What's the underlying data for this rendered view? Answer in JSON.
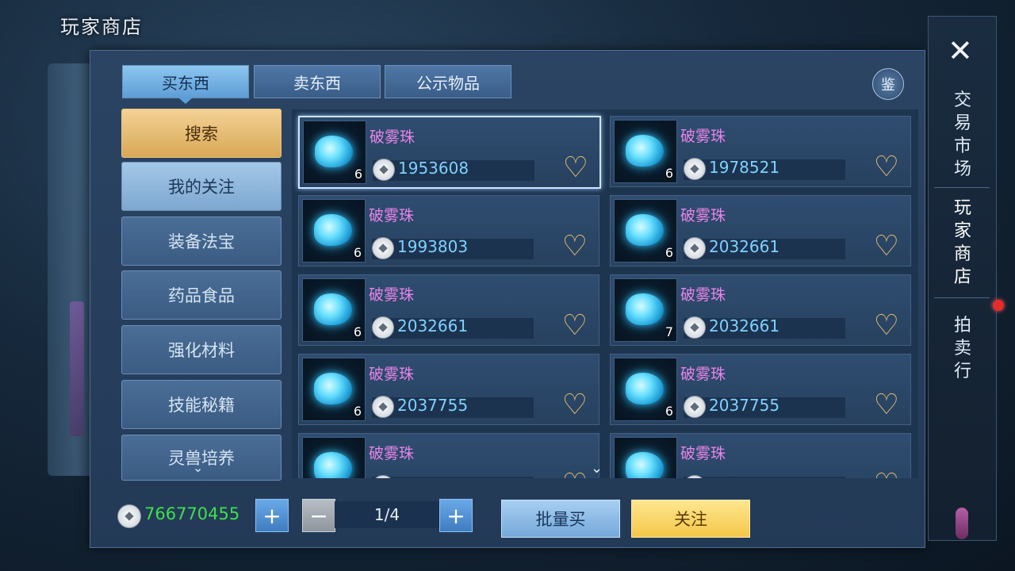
{
  "page_title": "玩家商店",
  "tabs": [
    {
      "label": "买东西",
      "active": true
    },
    {
      "label": "卖东西",
      "active": false
    },
    {
      "label": "公示物品",
      "active": false
    }
  ],
  "appraise_button": "鉴",
  "sidebar": {
    "search": "搜索",
    "items": [
      "我的关注",
      "装备法宝",
      "药品食品",
      "强化材料",
      "技能秘籍",
      "灵兽培养"
    ]
  },
  "listings": [
    {
      "name": "破雾珠",
      "qty": "6",
      "price": "1953608"
    },
    {
      "name": "破雾珠",
      "qty": "6",
      "price": "1978521"
    },
    {
      "name": "破雾珠",
      "qty": "6",
      "price": "1993803"
    },
    {
      "name": "破雾珠",
      "qty": "6",
      "price": "2032661"
    },
    {
      "name": "破雾珠",
      "qty": "6",
      "price": "2032661"
    },
    {
      "name": "破雾珠",
      "qty": "7",
      "price": "2032661"
    },
    {
      "name": "破雾珠",
      "qty": "6",
      "price": "2037755"
    },
    {
      "name": "破雾珠",
      "qty": "6",
      "price": "2037755"
    },
    {
      "name": "破雾珠",
      "qty": "",
      "price": ""
    },
    {
      "name": "破雾珠",
      "qty": "",
      "price": ""
    }
  ],
  "bottom": {
    "balance": "766770455",
    "page": "1/4",
    "batch_buy": "批量买",
    "follow": "关注"
  },
  "right_menu": {
    "trade_market": "交易市场",
    "player_shop": "玩家商店",
    "auction_house": "拍卖行"
  },
  "colors": {
    "item_name": "#e884e6",
    "price": "#7fd1ff",
    "balance": "#3fe04a",
    "heart": "#e6bf6a"
  }
}
